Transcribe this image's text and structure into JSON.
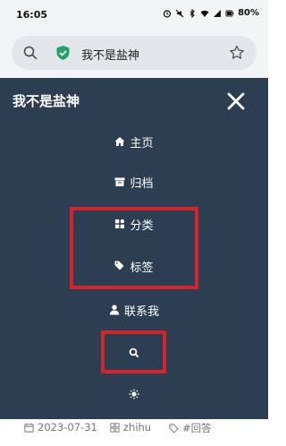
{
  "status_bar": {
    "time": "16:05",
    "battery": "80%",
    "icons": [
      "alarm-icon",
      "mute-icon",
      "bluetooth-icon",
      "wifi-icon",
      "signal-icon",
      "battery-icon"
    ]
  },
  "browser": {
    "address_text": "我不是盐神",
    "icons": [
      "search-icon",
      "shield-check-icon",
      "star-icon"
    ]
  },
  "nav": {
    "site_title": "我不是盐神",
    "items": [
      {
        "label": "主页",
        "icon": "home-icon"
      },
      {
        "label": "归档",
        "icon": "archive-icon"
      },
      {
        "label": "分类",
        "icon": "grid-icon"
      },
      {
        "label": "标签",
        "icon": "tags-icon"
      },
      {
        "label": "联系我",
        "icon": "user-icon"
      },
      {
        "label": "",
        "icon": "search-icon"
      },
      {
        "label": "",
        "icon": "sun-icon"
      }
    ]
  },
  "meta": {
    "date": "2023-07-31",
    "category": "zhihu",
    "tag": "#回答"
  },
  "colors": {
    "nav_bg": "#2e3e52",
    "highlight": "#d3242c",
    "shield": "#1fa463"
  }
}
